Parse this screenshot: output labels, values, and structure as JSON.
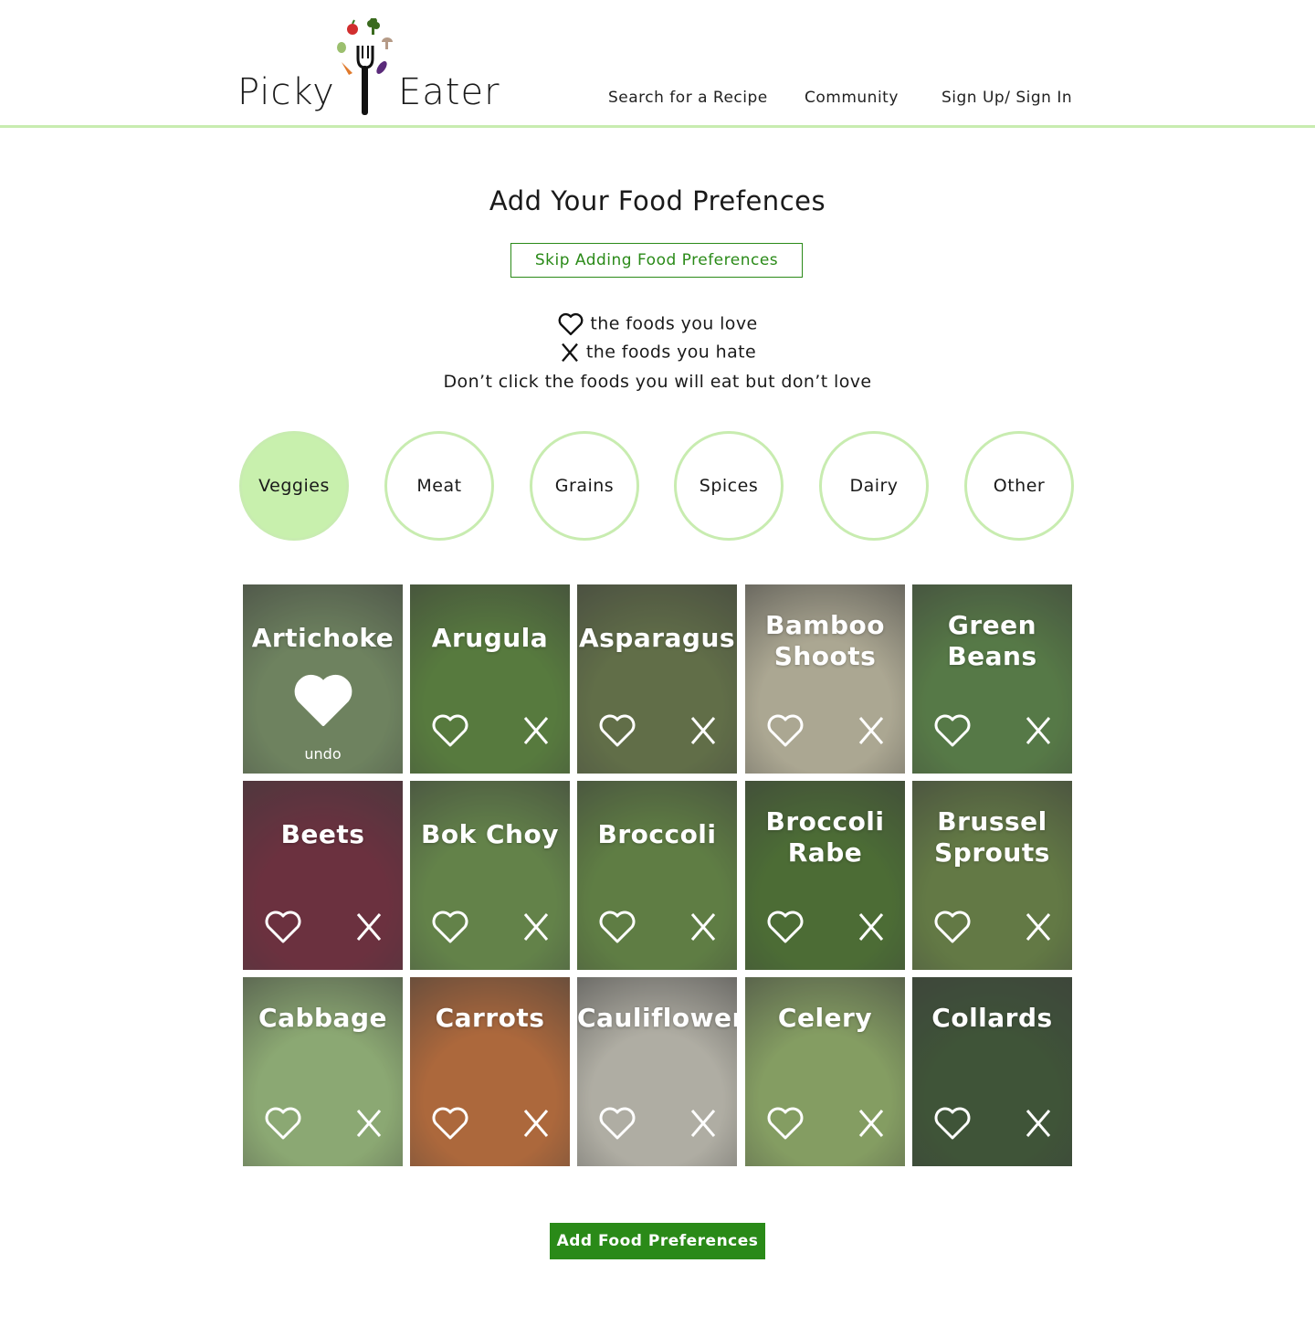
{
  "brand": {
    "word_left": "Picky",
    "word_right": "Eater"
  },
  "nav": {
    "search": "Search for a Recipe",
    "community": "Community",
    "signin": "Sign Up/ Sign In"
  },
  "page": {
    "title": "Add Your Food Prefences",
    "skip_label": "Skip Adding Food Preferences",
    "legend_love": "the foods you love",
    "legend_hate": "the foods you hate",
    "legend_note": "Don’t click the foods you will eat but don’t love"
  },
  "categories": [
    {
      "label": "Veggies",
      "active": true
    },
    {
      "label": "Meat",
      "active": false
    },
    {
      "label": "Grains",
      "active": false
    },
    {
      "label": "Spices",
      "active": false
    },
    {
      "label": "Dairy",
      "active": false
    },
    {
      "label": "Other",
      "active": false
    }
  ],
  "foods": [
    {
      "name": "Artichoke",
      "state": "loved",
      "undo_label": "undo",
      "color": "#7e9a6a"
    },
    {
      "name": "Arugula",
      "state": "none",
      "color": "#5f8f3c"
    },
    {
      "name": "Asparagus",
      "state": "none",
      "color": "#6c7e4a"
    },
    {
      "name": "Bamboo Shoots",
      "state": "none",
      "color": "#d3cdb0"
    },
    {
      "name": "Green Beans",
      "state": "none",
      "color": "#5e8e48"
    },
    {
      "name": "Beets",
      "state": "none",
      "color": "#7a2a3e"
    },
    {
      "name": "Bok Choy",
      "state": "none",
      "color": "#6f9a4c"
    },
    {
      "name": "Broccoli",
      "state": "none",
      "color": "#6a9444"
    },
    {
      "name": "Broccoli Rabe",
      "state": "none",
      "color": "#4f7c30"
    },
    {
      "name": "Brussel Sprouts",
      "state": "none",
      "color": "#6f8e46"
    },
    {
      "name": "Cabbage",
      "state": "none",
      "color": "#a7cf85"
    },
    {
      "name": "Carrots",
      "state": "none",
      "color": "#d4763a"
    },
    {
      "name": "Cauliflower",
      "state": "none",
      "color": "#d9d6c8"
    },
    {
      "name": "Celery",
      "state": "none",
      "color": "#9dbf6e"
    },
    {
      "name": "Collards",
      "state": "none",
      "color": "#3d5a34"
    }
  ],
  "submit_label": "Add Food Preferences",
  "colors": {
    "accent": "#2a8a18",
    "category_ring": "#c8ecb0",
    "category_active": "#c8f0ad"
  }
}
